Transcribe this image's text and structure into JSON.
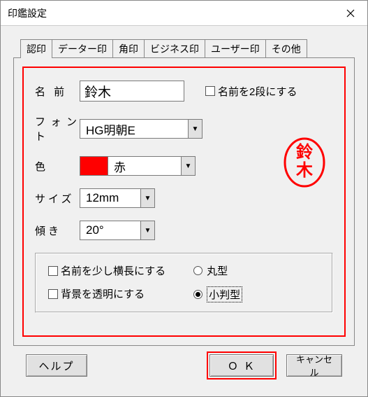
{
  "window": {
    "title": "印鑑設定"
  },
  "tabs": [
    "認印",
    "データー印",
    "角印",
    "ビジネス印",
    "ユーザー印",
    "その他"
  ],
  "form": {
    "name_label": "名 前",
    "name_value": "鈴木",
    "name_two_lines_label": "名前を2段にする",
    "font_label": "フォント",
    "font_value": "HG明朝E",
    "color_label": "色",
    "color_value": "赤",
    "color_hex": "#ff0000",
    "size_label": "サイズ",
    "size_value": "12mm",
    "tilt_label": "傾き",
    "tilt_value": "20°"
  },
  "options": {
    "elongate_label": "名前を少し横長にする",
    "transparent_label": "背景を透明にする",
    "round_label": "丸型",
    "oval_label": "小判型",
    "shape_selected": "oval"
  },
  "buttons": {
    "help": "ヘルプ",
    "ok": "Ｏ Ｋ",
    "cancel": "キャンセル"
  },
  "preview": {
    "text": "鈴木"
  }
}
